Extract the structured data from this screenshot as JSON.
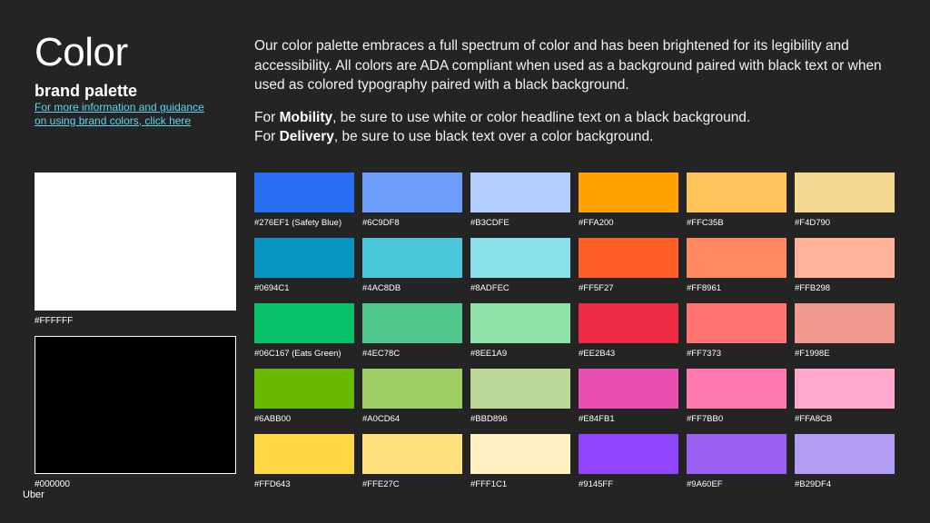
{
  "header": {
    "title": "Color",
    "subtitle": "brand palette",
    "link_line1": "For more information and guidance",
    "link_line2": "on using brand colors, click here"
  },
  "intro": {
    "paragraph": "Our color palette embraces a full spectrum of color and has been brightened for its legibility and accessibility. All colors are ADA compliant when used as a background paired with black text or when used as colored typography paired with a black background.",
    "mobility_prefix": "For ",
    "mobility_bold": "Mobility",
    "mobility_rest": ", be sure to use white or color headline text on a black background.",
    "delivery_prefix": "For ",
    "delivery_bold": "Delivery",
    "delivery_rest": ", be sure to use black text over a color background."
  },
  "primary": [
    {
      "label": "#FFFFFF",
      "color": "#FFFFFF"
    },
    {
      "label": "#000000",
      "color": "#000000"
    }
  ],
  "palette": [
    [
      {
        "label": "#276EF1 (Safety Blue)",
        "color": "#276EF1"
      },
      {
        "label": "#6C9DF8",
        "color": "#6C9DF8"
      },
      {
        "label": "#B3CDFE",
        "color": "#B3CDFE"
      },
      {
        "label": "#FFA200",
        "color": "#FFA200"
      },
      {
        "label": "#FFC35B",
        "color": "#FFC35B"
      },
      {
        "label": "#F4D790",
        "color": "#F4D790"
      }
    ],
    [
      {
        "label": "#0694C1",
        "color": "#0694C1"
      },
      {
        "label": "#4AC8DB",
        "color": "#4AC8DB"
      },
      {
        "label": "#8ADFEC",
        "color": "#8ADFEC"
      },
      {
        "label": "#FF5F27",
        "color": "#FF5F27"
      },
      {
        "label": "#FF8961",
        "color": "#FF8961"
      },
      {
        "label": "#FFB298",
        "color": "#FFB298"
      }
    ],
    [
      {
        "label": "#06C167 (Eats Green)",
        "color": "#06C167"
      },
      {
        "label": "#4EC78C",
        "color": "#4EC78C"
      },
      {
        "label": "#8EE1A9",
        "color": "#8EE1A9"
      },
      {
        "label": "#EE2B43",
        "color": "#EE2B43"
      },
      {
        "label": "#FF7373",
        "color": "#FF7373"
      },
      {
        "label": "#F1998E",
        "color": "#F1998E"
      }
    ],
    [
      {
        "label": "#6ABB00",
        "color": "#6ABB00"
      },
      {
        "label": "#A0CD64",
        "color": "#A0CD64"
      },
      {
        "label": "#BBD896",
        "color": "#BBD896"
      },
      {
        "label": "#E84FB1",
        "color": "#E84FB1"
      },
      {
        "label": "#FF7BB0",
        "color": "#FF7BB0"
      },
      {
        "label": "#FFA8CB",
        "color": "#FFA8CB"
      }
    ],
    [
      {
        "label": "#FFD643",
        "color": "#FFD643"
      },
      {
        "label": "#FFE27C",
        "color": "#FFE27C"
      },
      {
        "label": "#FFF1C1",
        "color": "#FFF1C1"
      },
      {
        "label": "#9145FF",
        "color": "#9145FF"
      },
      {
        "label": "#9A60EF",
        "color": "#9A60EF"
      },
      {
        "label": "#B29DF4",
        "color": "#B29DF4"
      }
    ]
  ],
  "footer": {
    "brand": "Uber"
  }
}
